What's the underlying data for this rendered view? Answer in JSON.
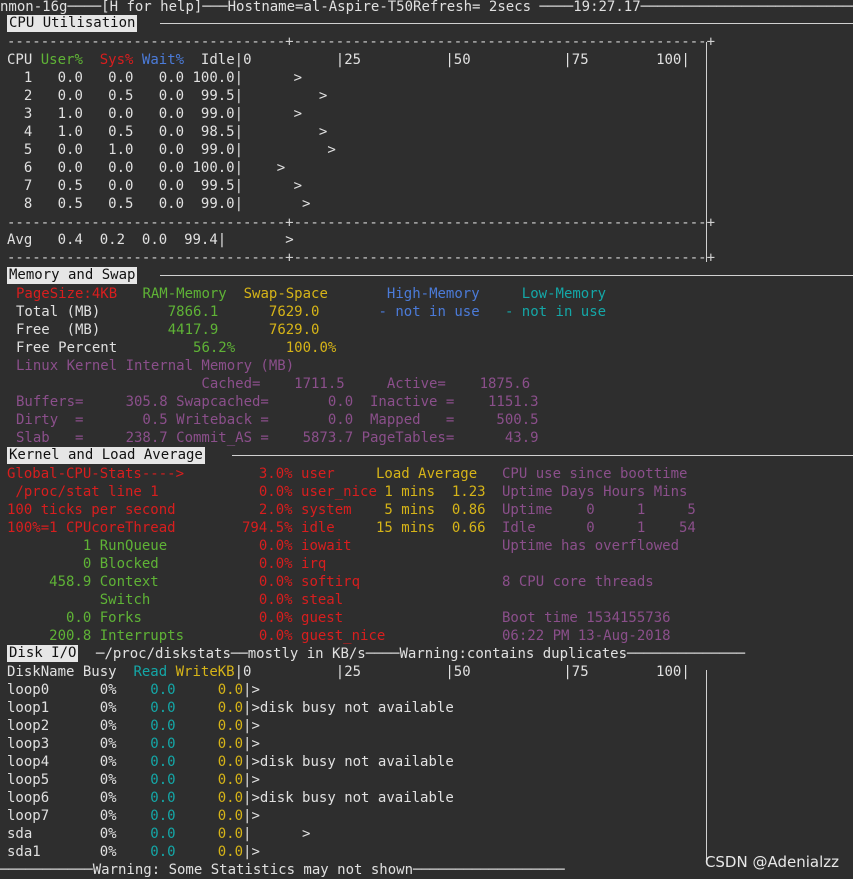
{
  "header": {
    "app": "nmon-16g",
    "help": "[H for help]",
    "hostname": "Hostname=al-Aspire-T50",
    "refresh": "Refresh= 2secs",
    "time": "19:27.17"
  },
  "cpu": {
    "title": "CPU Utilisation",
    "col_cpu": "CPU",
    "col_user": "User%",
    "col_sys": "Sys%",
    "col_wait": "Wait%",
    "col_idle": "Idle",
    "scale": "|0          |25          |50           |75        100|",
    "rows": [
      {
        "id": "1",
        "user": "0.0",
        "sys": "0.0",
        "wait": "0.0",
        "idle": "100.0",
        "bar": "      >"
      },
      {
        "id": "2",
        "user": "0.0",
        "sys": "0.5",
        "wait": "0.0",
        "idle": "99.5",
        "bar": "         >"
      },
      {
        "id": "3",
        "user": "1.0",
        "sys": "0.0",
        "wait": "0.0",
        "idle": "99.0",
        "bar": "      >"
      },
      {
        "id": "4",
        "user": "1.0",
        "sys": "0.5",
        "wait": "0.0",
        "idle": "98.5",
        "bar": "         >"
      },
      {
        "id": "5",
        "user": "0.0",
        "sys": "1.0",
        "wait": "0.0",
        "idle": "99.0",
        "bar": "          >"
      },
      {
        "id": "6",
        "user": "0.0",
        "sys": "0.0",
        "wait": "0.0",
        "idle": "100.0",
        "bar": "    >"
      },
      {
        "id": "7",
        "user": "0.5",
        "sys": "0.0",
        "wait": "0.0",
        "idle": "99.5",
        "bar": "      >"
      },
      {
        "id": "8",
        "user": "0.5",
        "sys": "0.5",
        "wait": "0.0",
        "idle": "99.0",
        "bar": "       >"
      }
    ],
    "avg": {
      "label": "Avg",
      "user": "0.4",
      "sys": "0.2",
      "wait": "0.0",
      "idle": "99.4",
      "bar": "       >"
    }
  },
  "memory": {
    "title": "Memory and Swap",
    "pagesize": "PageSize:4KB",
    "ram_label": "RAM-Memory",
    "swap_label": "Swap-Space",
    "high_label": "High-Memory",
    "low_label": "Low-Memory",
    "total_label": "Total (MB)",
    "total_ram": "7866.1",
    "total_swap": "7629.0",
    "high_status": "- not in use",
    "low_status": "- not in use",
    "free_label": "Free  (MB)",
    "free_ram": "4417.9",
    "free_swap": "7629.0",
    "freepct_label": "Free Percent",
    "freepct_ram": "56.2%",
    "freepct_swap": "100.0%",
    "kernel_title": "Linux Kernel Internal Memory (MB)",
    "k1": "                      Cached=    1711.5     Active=    1875.6",
    "k2": "Buffers=     305.8 Swapcached=       0.0  Inactive =    1151.3",
    "k3": "Dirty  =       0.5 Writeback =       0.0  Mapped   =     500.5",
    "k4": "Slab   =     238.7 Commit_AS =    5873.7 PageTables=      43.9"
  },
  "kernel": {
    "title": "Kernel and Load Average",
    "left": [
      "Global-CPU-Stats---->",
      " /proc/stat line 1",
      "100 ticks per second",
      "100%=1 CPUcoreThread"
    ],
    "pct": [
      {
        "v": "3.0%",
        "n": "user"
      },
      {
        "v": "0.0%",
        "n": "user_nice"
      },
      {
        "v": "2.0%",
        "n": "system"
      },
      {
        "v": "794.5%",
        "n": "idle"
      },
      {
        "v": "0.0%",
        "n": "iowait"
      },
      {
        "v": "0.0%",
        "n": "irq"
      },
      {
        "v": "0.0%",
        "n": "softirq"
      },
      {
        "v": "0.0%",
        "n": "steal"
      },
      {
        "v": "0.0%",
        "n": "guest"
      },
      {
        "v": "0.0%",
        "n": "guest_nice"
      }
    ],
    "load_title": "Load Average",
    "load": [
      {
        "m": "1 mins",
        "v": "1.23"
      },
      {
        "m": "5 mins",
        "v": "0.86"
      },
      {
        "m": "15 mins",
        "v": "0.66"
      }
    ],
    "counters": [
      {
        "v": "1",
        "n": "RunQueue"
      },
      {
        "v": "0",
        "n": "Blocked"
      },
      {
        "v": "458.9",
        "n": "Context"
      },
      {
        "v": "",
        "n": "Switch"
      },
      {
        "v": "0.0",
        "n": "Forks"
      },
      {
        "v": "200.8",
        "n": "Interrupts"
      }
    ],
    "boot": {
      "title": "CPU use since boottime",
      "hdr": "Uptime Days Hours Mins",
      "uptime": "Uptime    0     1     5",
      "idle": "Idle      0     1    54",
      "overflow": "Uptime has overflowed",
      "threads": "8 CPU core threads",
      "boot_time": "Boot time 1534155736",
      "boot_date": "06:22 PM 13-Aug-2018"
    }
  },
  "disk": {
    "title": "Disk I/O",
    "source": "/proc/diskstats",
    "units": "mostly in KB/s",
    "warning": "Warning:contains duplicates",
    "col_name": "DiskName",
    "col_busy": "Busy",
    "col_read": "Read",
    "col_write": "WriteKB",
    "scale": "|0          |25          |50           |75        100|",
    "rows": [
      {
        "name": "loop0",
        "busy": "0%",
        "read": "0.0",
        "write": "0.0",
        "bar": "|>"
      },
      {
        "name": "loop1",
        "busy": "0%",
        "read": "0.0",
        "write": "0.0",
        "bar": "|>disk busy not available"
      },
      {
        "name": "loop2",
        "busy": "0%",
        "read": "0.0",
        "write": "0.0",
        "bar": "|>"
      },
      {
        "name": "loop3",
        "busy": "0%",
        "read": "0.0",
        "write": "0.0",
        "bar": "|>"
      },
      {
        "name": "loop4",
        "busy": "0%",
        "read": "0.0",
        "write": "0.0",
        "bar": "|>disk busy not available"
      },
      {
        "name": "loop5",
        "busy": "0%",
        "read": "0.0",
        "write": "0.0",
        "bar": "|>"
      },
      {
        "name": "loop6",
        "busy": "0%",
        "read": "0.0",
        "write": "0.0",
        "bar": "|>disk busy not available"
      },
      {
        "name": "loop7",
        "busy": "0%",
        "read": "0.0",
        "write": "0.0",
        "bar": "|>"
      },
      {
        "name": "sda",
        "busy": "0%",
        "read": "0.0",
        "write": "0.0",
        "bar": "|      >"
      },
      {
        "name": "sda1",
        "busy": "0%",
        "read": "0.0",
        "write": "0.0",
        "bar": "|>"
      }
    ],
    "footer": "Warning: Some Statistics may not shown"
  },
  "watermark": "CSDN @Adenialzz"
}
